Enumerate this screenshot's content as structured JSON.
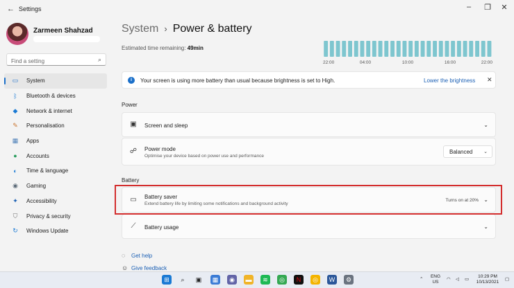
{
  "window": {
    "title": "Settings"
  },
  "user": {
    "name": "Zarmeen Shahzad"
  },
  "search": {
    "placeholder": "Find a setting"
  },
  "sidebar": {
    "items": [
      {
        "label": "System",
        "icon": "monitor-icon",
        "color": "#1a6fc9",
        "glyph": "▭",
        "active": true
      },
      {
        "label": "Bluetooth & devices",
        "icon": "bluetooth-icon",
        "color": "#1a7ad4",
        "glyph": "ᛒ"
      },
      {
        "label": "Network & internet",
        "icon": "wifi-icon",
        "color": "#1a7ad4",
        "glyph": "◆"
      },
      {
        "label": "Personalisation",
        "icon": "brush-icon",
        "color": "#c8732e",
        "glyph": "✎"
      },
      {
        "label": "Apps",
        "icon": "apps-icon",
        "color": "#4c7fb8",
        "glyph": "▦"
      },
      {
        "label": "Accounts",
        "icon": "person-icon",
        "color": "#2a9d5e",
        "glyph": "●"
      },
      {
        "label": "Time & language",
        "icon": "globe-clock-icon",
        "color": "#1a7ad4",
        "glyph": "◐"
      },
      {
        "label": "Gaming",
        "icon": "gamepad-icon",
        "color": "#5d6b78",
        "glyph": "◉"
      },
      {
        "label": "Accessibility",
        "icon": "accessibility-icon",
        "color": "#1a5fb4",
        "glyph": "✦"
      },
      {
        "label": "Privacy & security",
        "icon": "shield-icon",
        "color": "#6b6b6b",
        "glyph": "⛉"
      },
      {
        "label": "Windows Update",
        "icon": "update-icon",
        "color": "#1a7ad4",
        "glyph": "↻"
      }
    ]
  },
  "breadcrumb": {
    "parent": "System",
    "separator": "›",
    "current": "Power & battery"
  },
  "estimate": {
    "label": "Estimated time remaining:",
    "value": "49min"
  },
  "battery_chart": {
    "x_ticks": [
      "22:00",
      "04:00",
      "10:00",
      "16:00",
      "22:00"
    ],
    "bar_count": 28,
    "bar_color": "#7ec6cf"
  },
  "notice": {
    "text": "Your screen is using more battery than usual because brightness is set to High.",
    "link": "Lower the brightness"
  },
  "power": {
    "heading": "Power",
    "screen_sleep": {
      "title": "Screen and sleep"
    },
    "power_mode": {
      "title": "Power mode",
      "subtitle": "Optimise your device based on power use and performance",
      "value": "Balanced"
    }
  },
  "battery": {
    "heading": "Battery",
    "saver": {
      "title": "Battery saver",
      "subtitle": "Extend battery life by limiting some notifications and background activity",
      "status": "Turns on at 20%"
    },
    "usage": {
      "title": "Battery usage"
    }
  },
  "links": {
    "help": "Get help",
    "feedback": "Give feedback"
  },
  "tray": {
    "lang": "ENG",
    "region": "US",
    "time": "10:29 PM",
    "date": "10/13/2021"
  }
}
